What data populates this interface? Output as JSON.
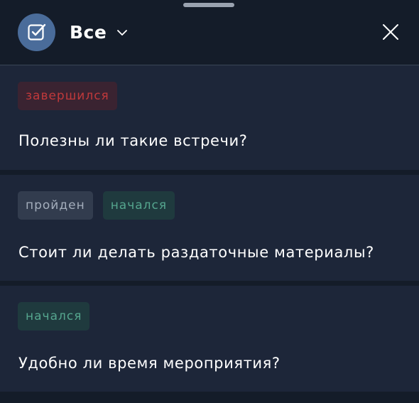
{
  "header": {
    "filter_label": "Все"
  },
  "polls": [
    {
      "badges": [
        {
          "label": "завершился",
          "status": "ended",
          "color": "#c0393b"
        }
      ],
      "question": "Полезны ли такие встречи?"
    },
    {
      "badges": [
        {
          "label": "пройден",
          "status": "passed",
          "color": "#a4aebc"
        },
        {
          "label": "начался",
          "status": "started",
          "color": "#55a58e"
        }
      ],
      "question": "Стоит ли делать раздаточные материалы?"
    },
    {
      "badges": [
        {
          "label": "начался",
          "status": "started",
          "color": "#55a58e"
        }
      ],
      "question": "Удобно ли время мероприятия?"
    }
  ],
  "icons": {
    "filter": "checkbox-icon",
    "dropdown": "chevron-down-icon",
    "close": "close-icon"
  },
  "colors": {
    "background": "#141c29",
    "card": "#1d2639",
    "accent": "#4a6c9a"
  }
}
